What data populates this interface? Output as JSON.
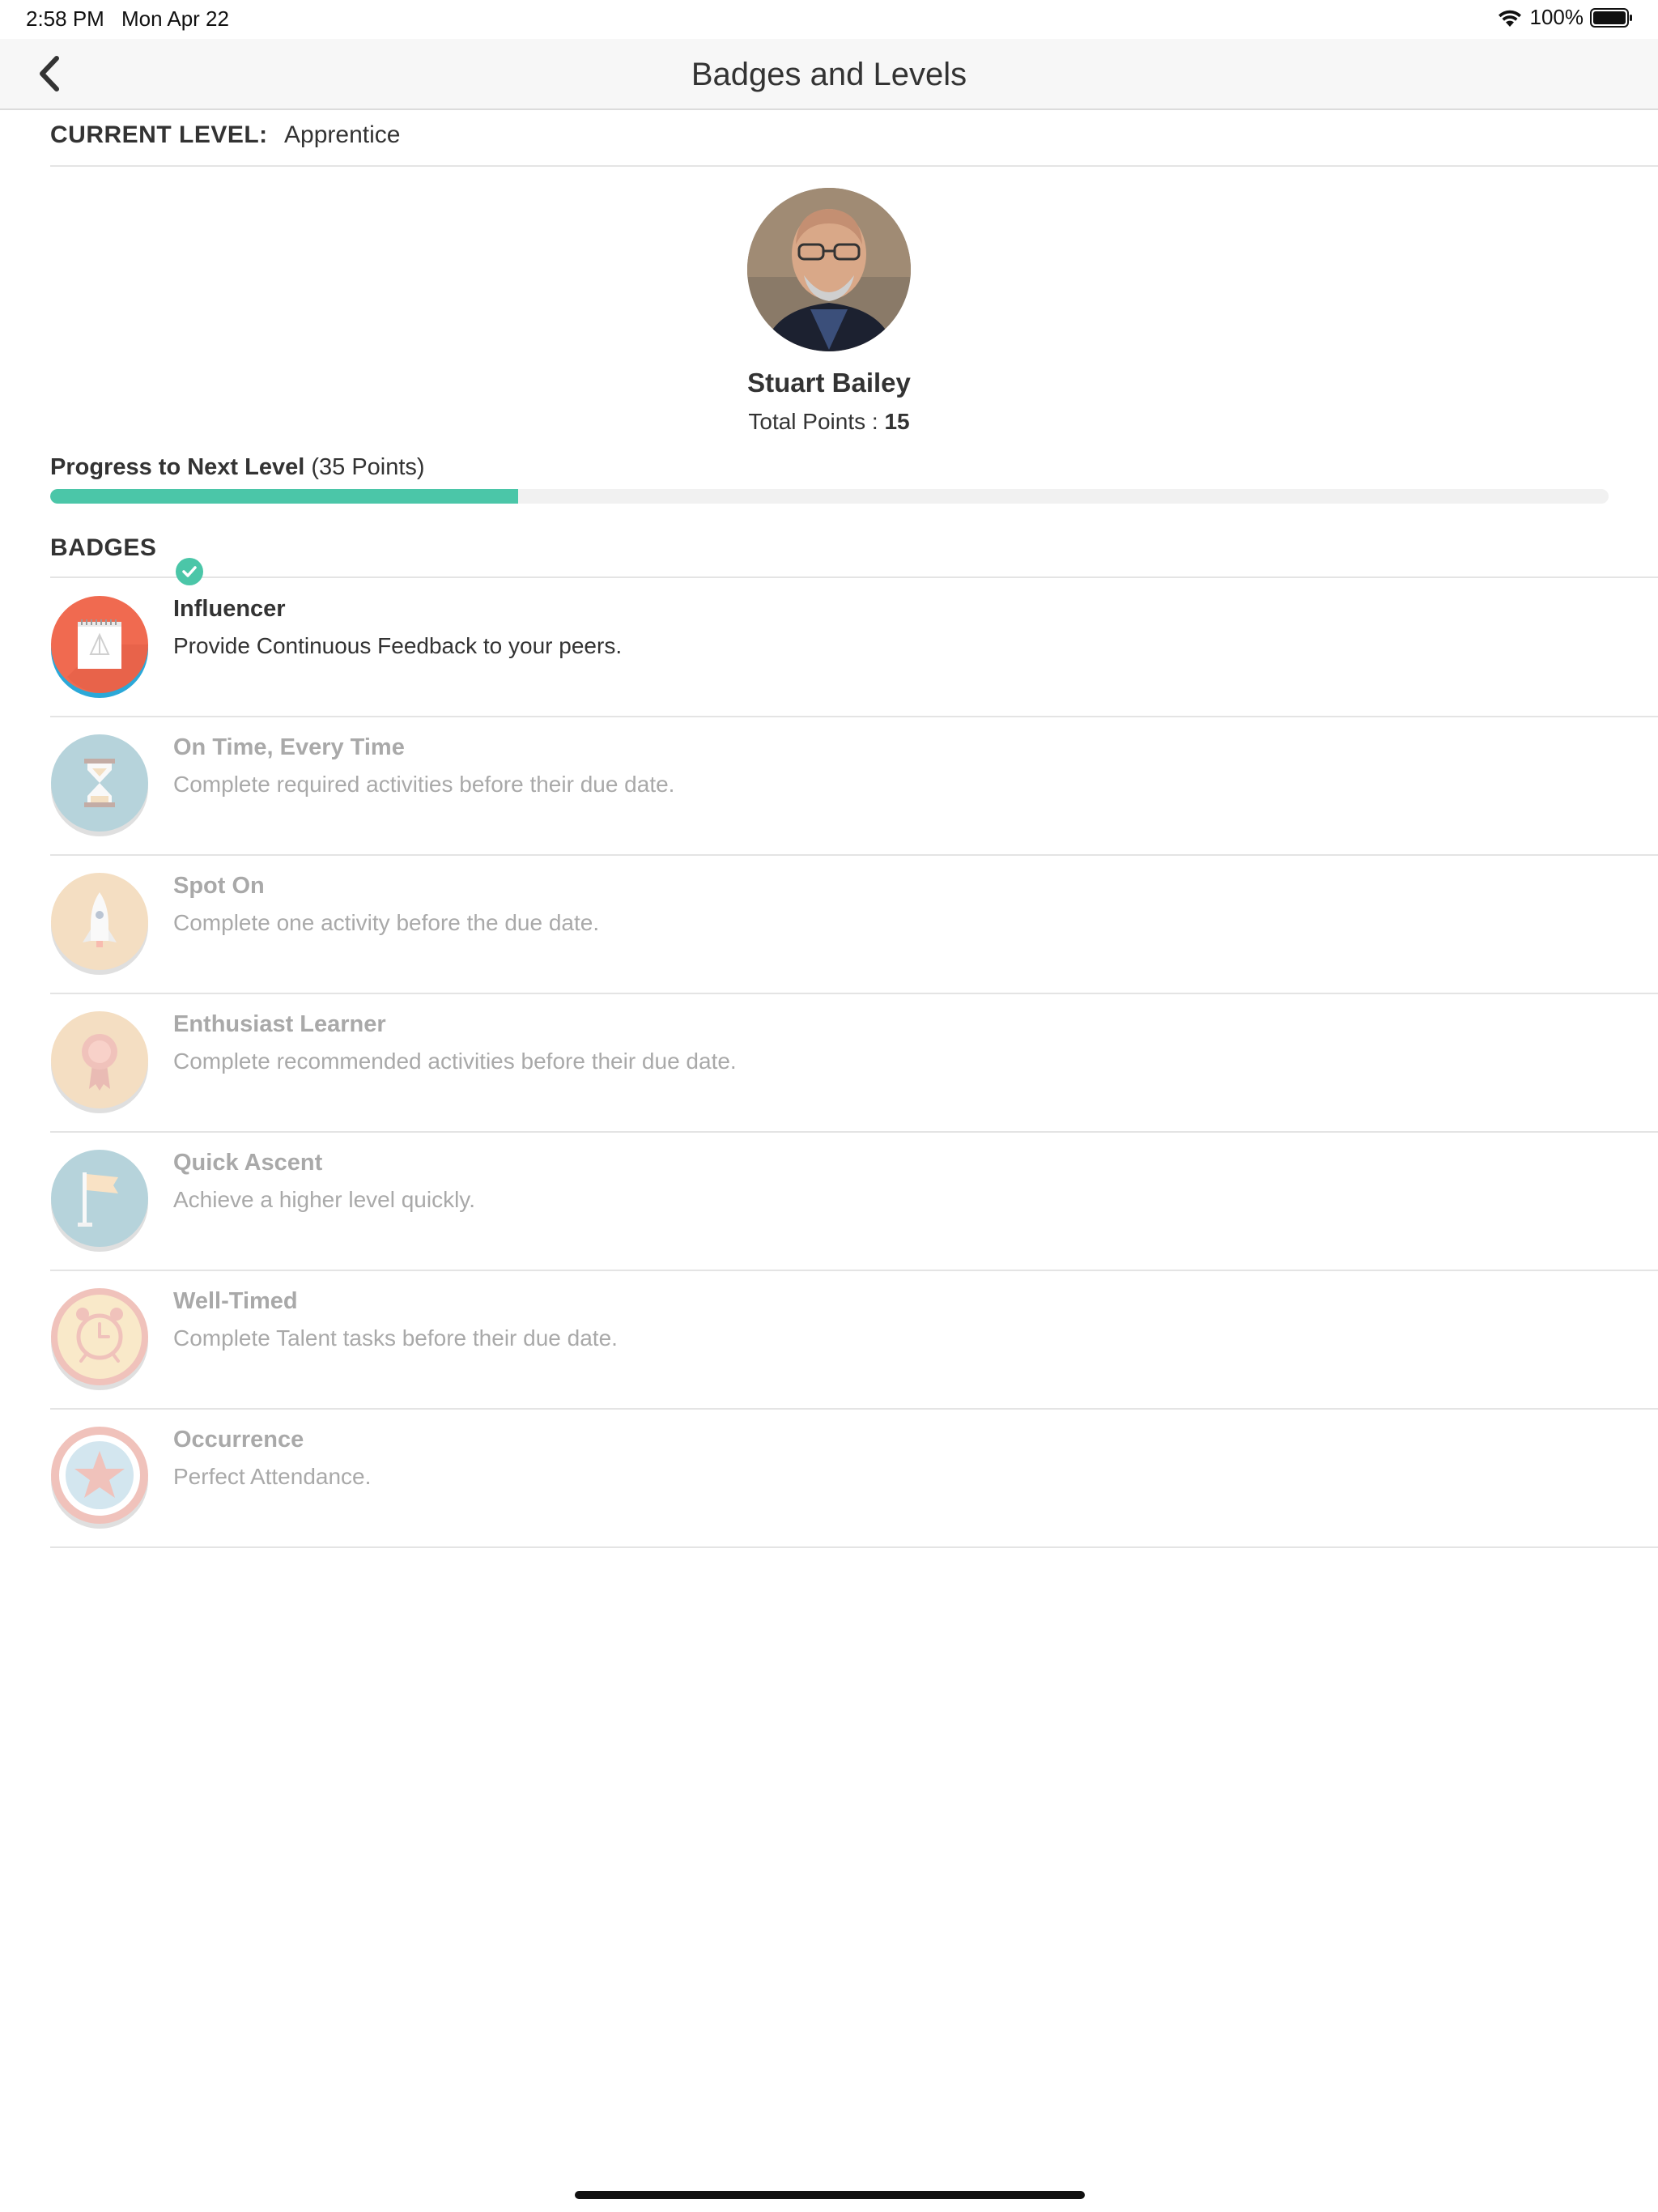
{
  "status_bar": {
    "time": "2:58 PM",
    "date": "Mon Apr 22",
    "battery": "100%"
  },
  "nav": {
    "title": "Badges and Levels",
    "back_icon": "chevron-left-icon"
  },
  "level": {
    "label": "CURRENT LEVEL:",
    "value": "Apprentice"
  },
  "profile": {
    "name": "Stuart Bailey",
    "points_label": "Total Points : ",
    "points": "15"
  },
  "progress": {
    "label": "Progress to Next Level",
    "points": "(35 Points)",
    "fraction": 0.3
  },
  "badges": {
    "header": "BADGES",
    "items": [
      {
        "title": "Influencer",
        "desc": "Provide Continuous Feedback to your peers.",
        "earned": true,
        "icon": "notepad-icon"
      },
      {
        "title": "On Time, Every Time",
        "desc": "Complete required activities before their due date.",
        "earned": false,
        "icon": "hourglass-icon"
      },
      {
        "title": "Spot On",
        "desc": "Complete one activity before the due date.",
        "earned": false,
        "icon": "rocket-icon"
      },
      {
        "title": "Enthusiast Learner",
        "desc": "Complete recommended activities before their due date.",
        "earned": false,
        "icon": "medal-icon"
      },
      {
        "title": "Quick Ascent",
        "desc": "Achieve a higher level quickly.",
        "earned": false,
        "icon": "flag-icon"
      },
      {
        "title": "Well-Timed",
        "desc": "Complete Talent tasks before their due date.",
        "earned": false,
        "icon": "alarm-clock-icon"
      },
      {
        "title": "Occurrence",
        "desc": "Perfect Attendance.",
        "earned": false,
        "icon": "star-icon"
      }
    ]
  },
  "colors": {
    "accent": "#4bc6a8",
    "earned_badge": "#f06a50",
    "earned_ring": "#2ba8d8"
  }
}
